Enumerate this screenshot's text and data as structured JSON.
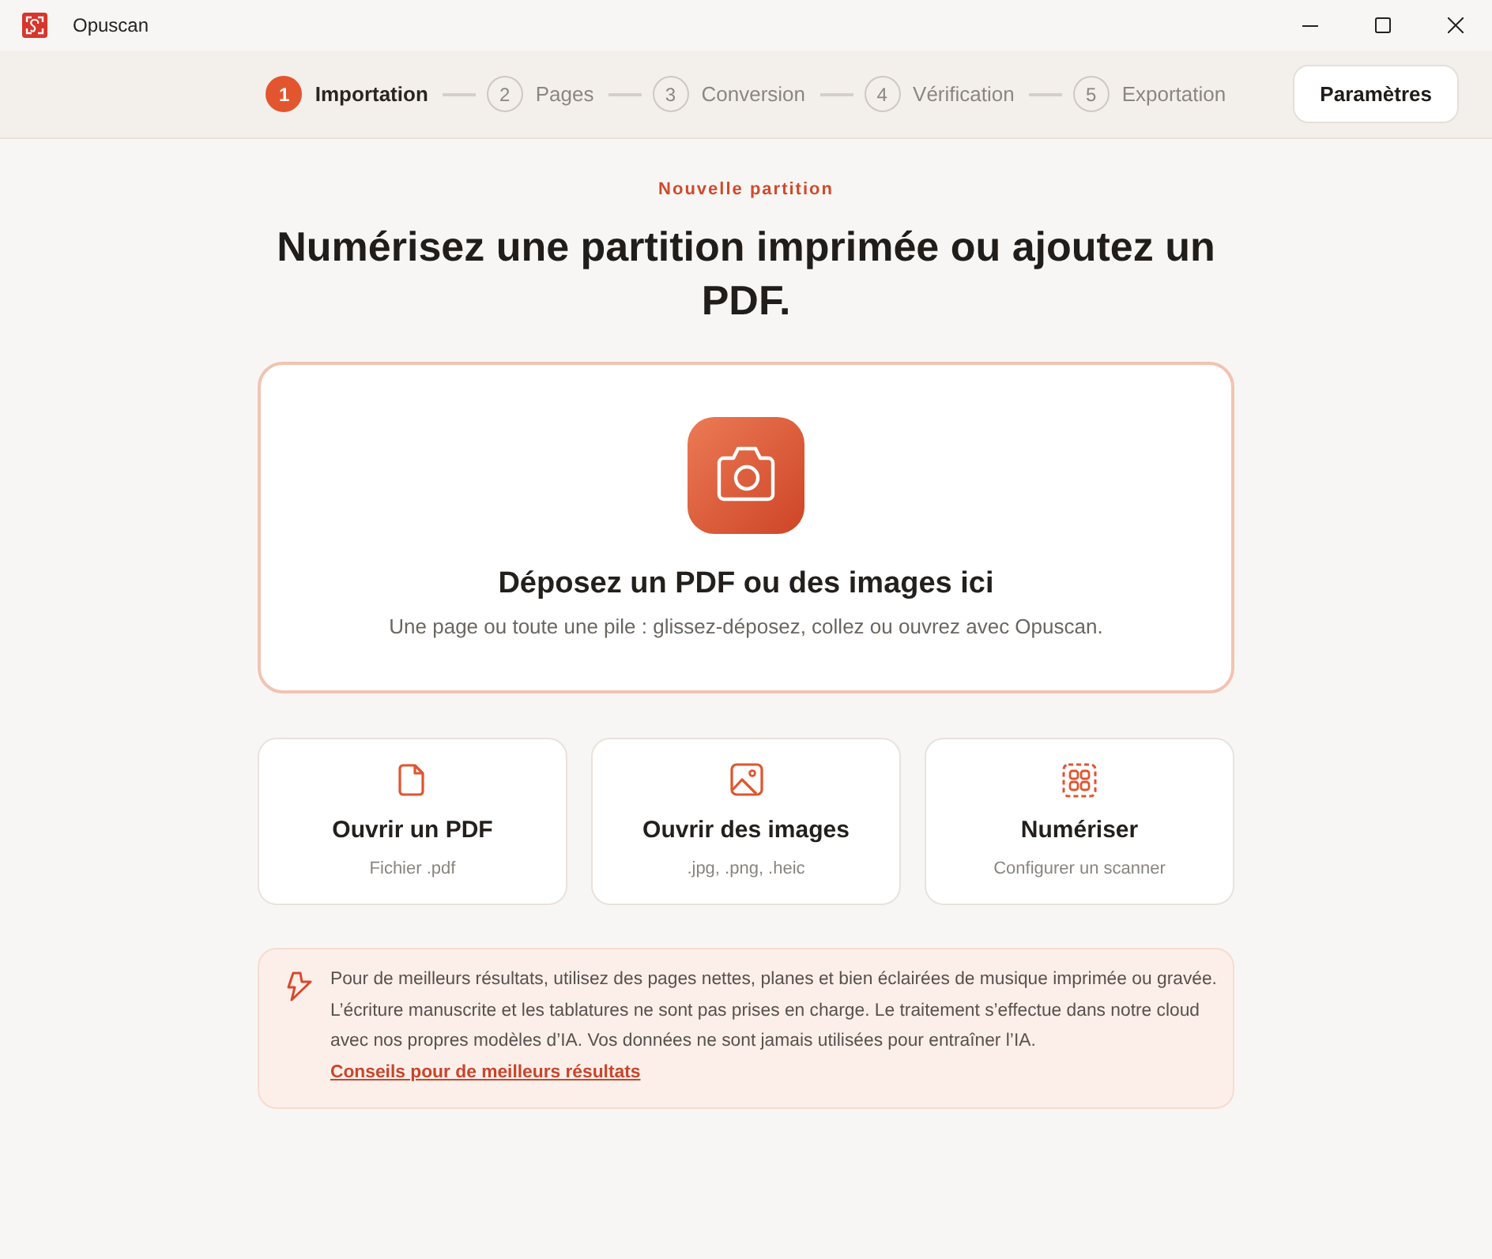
{
  "window": {
    "title": "Opuscan"
  },
  "stepper": {
    "steps": [
      {
        "number": "1",
        "label": "Importation",
        "selected": true
      },
      {
        "number": "2",
        "label": "Pages",
        "selected": false
      },
      {
        "number": "3",
        "label": "Conversion",
        "selected": false
      },
      {
        "number": "4",
        "label": "Vérification",
        "selected": false
      },
      {
        "number": "5",
        "label": "Exportation",
        "selected": false
      }
    ]
  },
  "toolbar": {
    "settings_button": "Paramètres"
  },
  "header": {
    "eyebrow": "Nouvelle partition",
    "heading": "Numérisez une partition imprimée ou ajoutez un PDF."
  },
  "drop_zone": {
    "title": "Déposez un PDF ou des images ici",
    "subtitle": "Une page ou toute une pile : glissez-déposez, collez ou ouvrez avec Opuscan."
  },
  "actions": [
    {
      "kind": "pdf",
      "title": "Ouvrir un PDF",
      "subtitle": "Fichier .pdf"
    },
    {
      "kind": "images",
      "title": "Ouvrir des images",
      "subtitle": ".jpg, .png, .heic"
    },
    {
      "kind": "scan",
      "title": "Numériser",
      "subtitle": "Configurer un scanner"
    }
  ],
  "notice": {
    "text": "Pour de meilleurs résultats, utilisez des pages nettes, planes et bien éclairées de musique imprimée ou gravée. L’écriture manuscrite et les tablatures ne sont pas prises en charge. Le traitement s’effectue dans notre cloud avec nos propres modèles d’IA. Vos données ne sont jamais utilisées pour entraîner l’IA.",
    "link": "Conseils pour de meilleurs résultats"
  }
}
